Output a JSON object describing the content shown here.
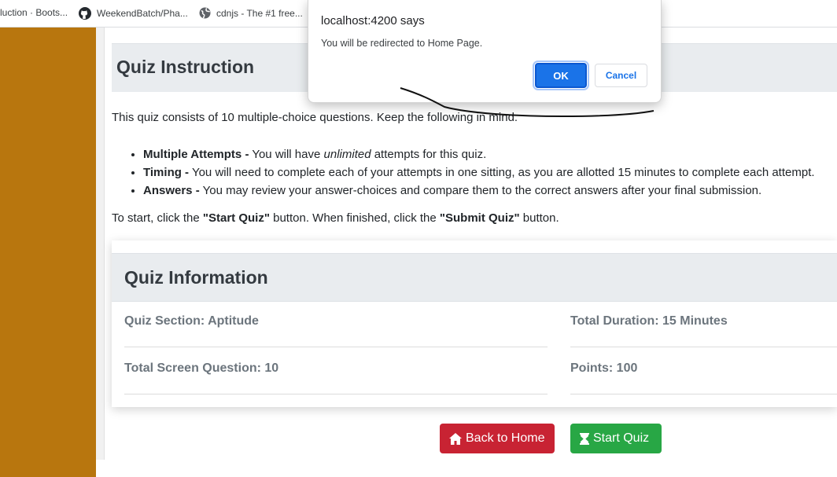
{
  "bookmarks": [
    {
      "label": "luction · Boots...",
      "icon": "bootstrap-icon"
    },
    {
      "label": "WeekendBatch/Pha...",
      "icon": "github-icon"
    },
    {
      "label": "cdnjs - The #1 free...",
      "icon": "globe-icon"
    }
  ],
  "instruction": {
    "title": "Quiz Instruction",
    "intro": "This quiz consists of 10 multiple-choice questions. Keep the following in mind:",
    "rules": [
      {
        "term": "Multiple Attempts -",
        "pre": " You will have ",
        "emph": "unlimited",
        "post": " attempts for this quiz."
      },
      {
        "term": "Timing -",
        "text": " You will need to complete each of your attempts in one sitting, as you are allotted 15 minutes to complete each attempt."
      },
      {
        "term": "Answers -",
        "text": " You may review your answer-choices and compare them to the correct answers after your final submission."
      }
    ],
    "start_note": {
      "pre": "To start, click the ",
      "start_btn": "\"Start Quiz\"",
      "mid": " button. When finished, click the ",
      "submit_btn": "\"Submit Quiz\"",
      "post": " button."
    }
  },
  "info": {
    "title": "Quiz Information",
    "section": "Quiz Section: Aptitude",
    "duration": "Total Duration: 15 Minutes",
    "questions": "Total Screen Question: 10",
    "points": "Points: 100"
  },
  "actions": {
    "back_home": "Back to Home",
    "start_quiz": "Start Quiz"
  },
  "dialog": {
    "title": "localhost:4200 says",
    "message": "You will be redirected to Home Page.",
    "ok": "OK",
    "cancel": "Cancel"
  },
  "colors": {
    "sidebar": "#b8760e",
    "danger": "#c82333",
    "success": "#28a745",
    "primary": "#1a73e8"
  }
}
